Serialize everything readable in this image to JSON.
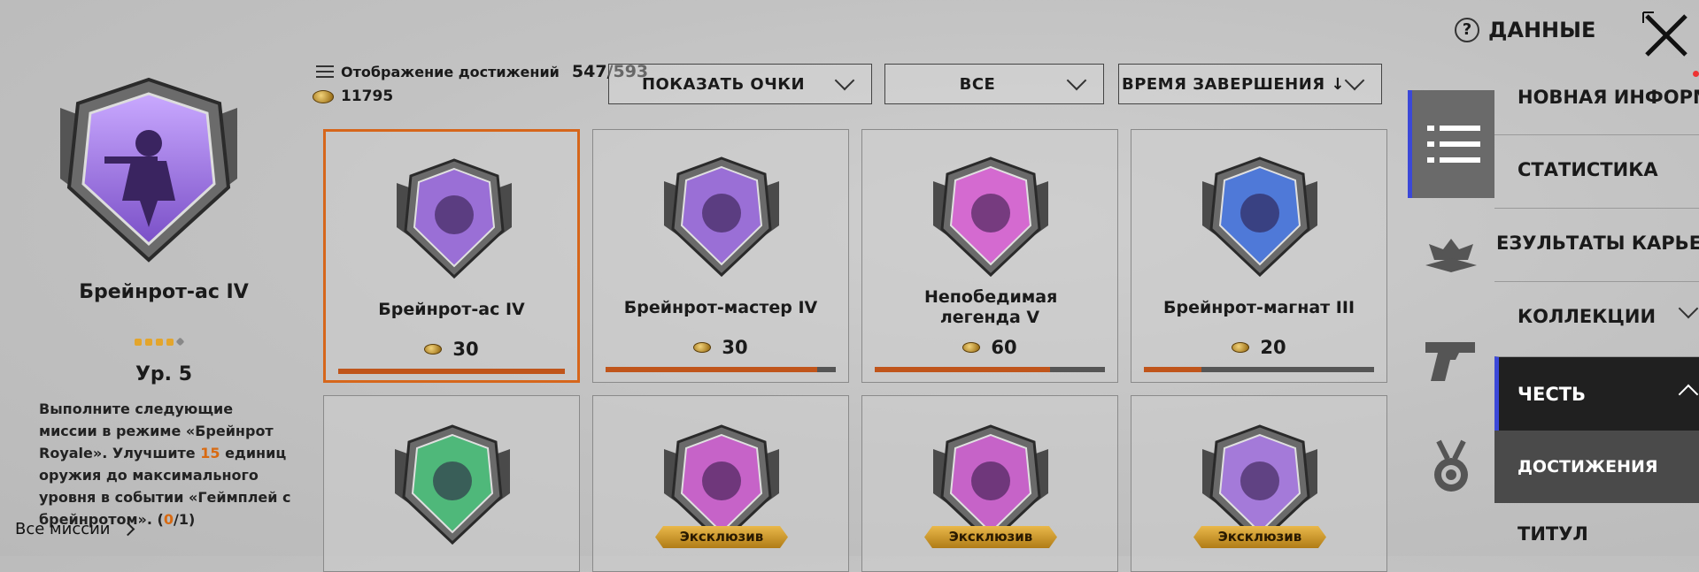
{
  "detail": {
    "title": "Брейнрот-ас IV",
    "stars_filled": 4,
    "stars_total": 5,
    "level": "Ур. 5",
    "desc_part1": "Выполните следующие миссии в режиме «Брейнрот Royale». Улучшите ",
    "desc_highlight": "15",
    "desc_part2": " единиц оружия до максимального уровня в событии «Геймплей с брейнротом». (",
    "desc_progress": "0",
    "desc_part3": "/1)",
    "all_missions": "Все миссии"
  },
  "stats": {
    "display_label": "Отображение достижений",
    "display_count": "547/593",
    "points": "11795"
  },
  "filters": [
    {
      "label": "ПОКАЗАТЬ ОЧКИ"
    },
    {
      "label": "ВСЕ"
    },
    {
      "label": "ВРЕМЯ ЗАВЕРШЕНИЯ ↓"
    }
  ],
  "cards": [
    {
      "name": "Брейнрот-ас IV",
      "points": "30",
      "progress": 1.0,
      "selected": true,
      "color": "#9a6fd6"
    },
    {
      "name": "Брейнрот-мастер IV",
      "points": "30",
      "progress": 0.92,
      "color": "#9a6fd6"
    },
    {
      "name": "Непобедимая легенда V",
      "points": "60",
      "progress": 0.76,
      "color": "#d46ad0"
    },
    {
      "name": "Брейнрот-магнат III",
      "points": "20",
      "progress": 0.25,
      "color": "#4f79d8"
    },
    {
      "color": "#4fb87a"
    },
    {
      "tag": "Эксклюзив",
      "color": "#c663c8"
    },
    {
      "tag": "Эксклюзив",
      "color": "#c663c8"
    },
    {
      "tag": "Эксклюзив",
      "color": "#a47ad9"
    }
  ],
  "top": {
    "data_label": "ДАННЫЕ",
    "help_glyph": "?"
  },
  "menu": {
    "items": [
      "НОВНАЯ ИНФОРМАЦИЯ",
      "СТАТИСТИКА",
      "ЕЗУЛЬТАТЫ КАРЬЕРЫ",
      "КОЛЛЕКЦИИ",
      "ЧЕСТЬ",
      "ДОСТИЖЕНИЯ",
      "ТИТУЛ"
    ]
  },
  "colors": {
    "accent_orange": "#d6661b",
    "accent_blue": "#3b48d8",
    "gold": "#e3a52c"
  }
}
